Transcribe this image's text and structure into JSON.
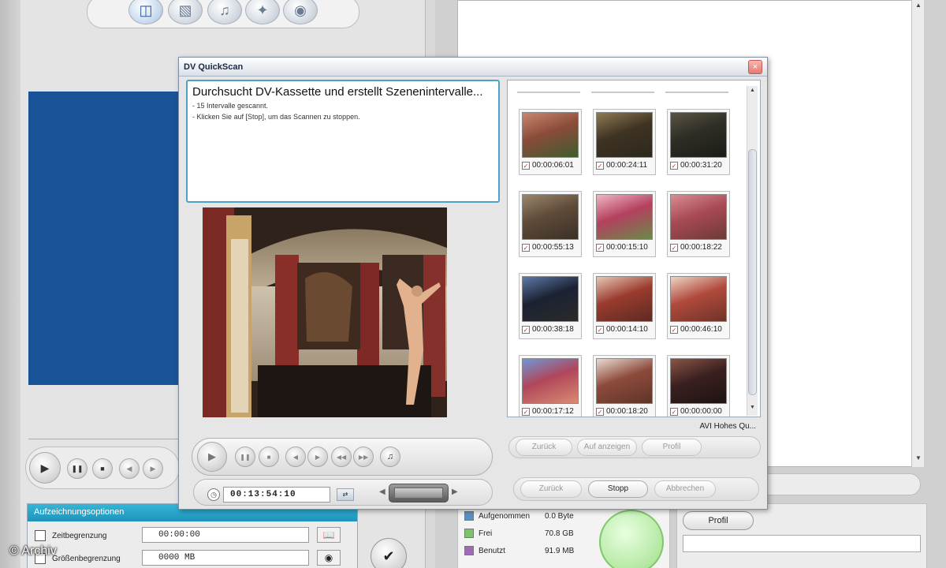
{
  "watermark": "© Archiv",
  "main_toolbar": {
    "icons": [
      "capture-icon",
      "edit-icon",
      "audio-icon",
      "effects-icon",
      "disc-icon"
    ]
  },
  "recording_options": {
    "header": "Aufzeichnungsoptionen",
    "rows": [
      {
        "label": "Zeitbegrenzung",
        "value": "00:00:00"
      },
      {
        "label": "Größenbegrenzung",
        "value": "0000 MB"
      }
    ]
  },
  "disk_legend": [
    {
      "label": "Aufgenommen",
      "value": "0.0 Byte",
      "color": "#5a8fc8"
    },
    {
      "label": "Frei",
      "value": "70.8 GB",
      "color": "#7cc46a"
    },
    {
      "label": "Benutzt",
      "value": "91.9 MB",
      "color": "#a16ab8"
    }
  ],
  "profile_button": "Profil",
  "dialog": {
    "title": "DV QuickScan",
    "close_label": "×",
    "status_title": "Durchsucht DV-Kassette und erstellt Szenenintervalle...",
    "status_lines": [
      "- 15 Intervalle gescannt.",
      "- Klicken Sie auf [Stop], um das Scannen zu stoppen."
    ],
    "timecode": "00:13:54:10",
    "format_label": "AVI Hohes Qu...",
    "thumbnails": [
      {
        "tc": "00:00:06:01",
        "checked": true,
        "colors": [
          "#8a4b3a",
          "#c9876d",
          "#3d5d2f"
        ]
      },
      {
        "tc": "00:00:24:11",
        "checked": true,
        "colors": [
          "#3f3322",
          "#8f7a55",
          "#2c281e"
        ]
      },
      {
        "tc": "00:00:31:20",
        "checked": true,
        "colors": [
          "#2e2e26",
          "#5a5443",
          "#1c1c17"
        ]
      },
      {
        "tc": "00:00:55:13",
        "checked": true,
        "colors": [
          "#5f4b39",
          "#9a876c",
          "#3a3026"
        ]
      },
      {
        "tc": "00:00:15:10",
        "checked": true,
        "colors": [
          "#b4405e",
          "#f1b5c4",
          "#6a8a4b"
        ]
      },
      {
        "tc": "00:00:18:22",
        "checked": true,
        "colors": [
          "#a84a55",
          "#d98d93",
          "#6c3a36"
        ]
      },
      {
        "tc": "00:00:38:18",
        "checked": true,
        "colors": [
          "#1c2233",
          "#5d7aa8",
          "#2a2a2a"
        ]
      },
      {
        "tc": "00:00:14:10",
        "checked": true,
        "colors": [
          "#9a3b2e",
          "#e7c7b3",
          "#5d2a22"
        ]
      },
      {
        "tc": "00:00:46:10",
        "checked": true,
        "colors": [
          "#b04a3c",
          "#edd5c5",
          "#6e3328"
        ]
      },
      {
        "tc": "00:00:17:12",
        "checked": true,
        "colors": [
          "#b0465a",
          "#6f97d6",
          "#d98b73"
        ]
      },
      {
        "tc": "00:00:18:20",
        "checked": true,
        "colors": [
          "#8d4a3b",
          "#e9dcd2",
          "#5e3529"
        ]
      },
      {
        "tc": "00:00:00:00",
        "checked": true,
        "colors": [
          "#3a2020",
          "#8a5546",
          "#1e1212"
        ]
      }
    ],
    "buttons_row1": [
      "Zurück",
      "Auf anzeigen",
      "Profil"
    ],
    "buttons_row2": [
      "Zurück",
      "Stopp",
      "Abbrechen"
    ]
  }
}
